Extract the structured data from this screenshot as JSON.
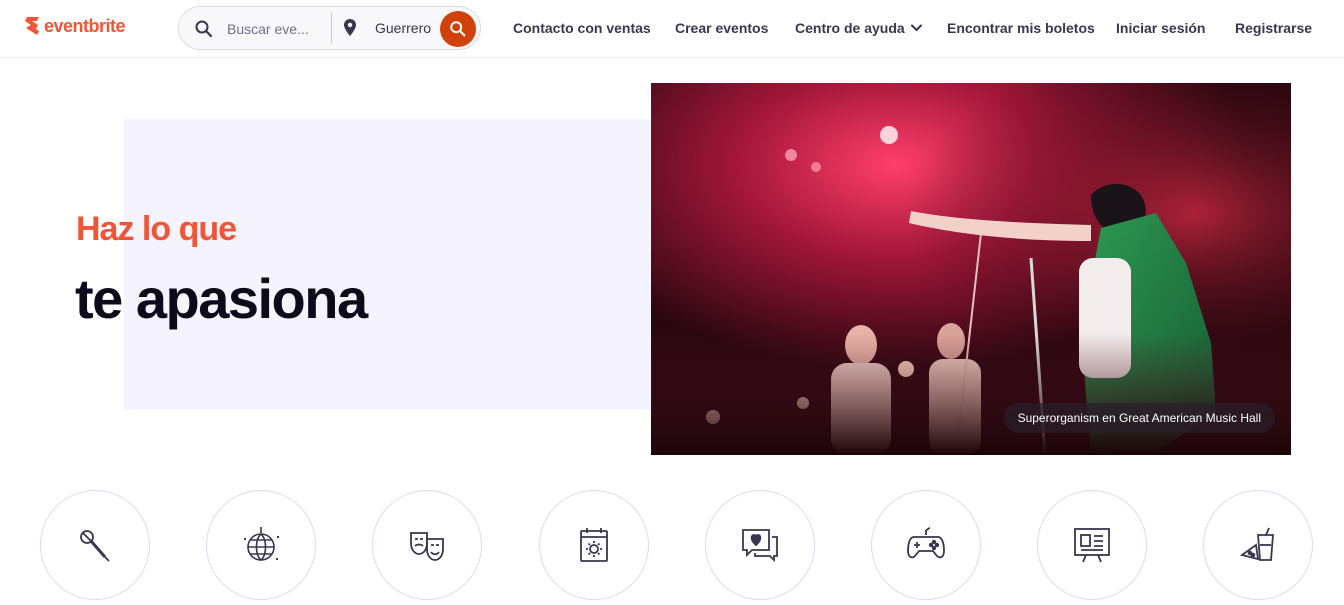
{
  "header": {
    "logo_text": "eventbrite",
    "search": {
      "placeholder": "Buscar eve...",
      "location": "Guerrero"
    },
    "nav": {
      "contact": "Contacto con ventas",
      "create": "Crear eventos",
      "help": "Centro de ayuda",
      "tickets": "Encontrar mis boletos",
      "login": "Iniciar sesión",
      "signup": "Registrarse"
    }
  },
  "hero": {
    "line1": "Haz lo que",
    "line2": "te apasiona",
    "caption": "Superorganism en Great American Music Hall"
  },
  "categories": [
    {
      "icon": "microphone-icon"
    },
    {
      "icon": "disco-ball-icon"
    },
    {
      "icon": "theater-masks-icon"
    },
    {
      "icon": "calendar-sun-icon"
    },
    {
      "icon": "chat-heart-icon"
    },
    {
      "icon": "gamepad-icon"
    },
    {
      "icon": "presentation-board-icon"
    },
    {
      "icon": "food-drink-icon"
    }
  ],
  "colors": {
    "brand": "#f05537",
    "search_button": "#d1410c",
    "text_dark": "#39364f",
    "hero_bg": "#f5f4fe"
  }
}
